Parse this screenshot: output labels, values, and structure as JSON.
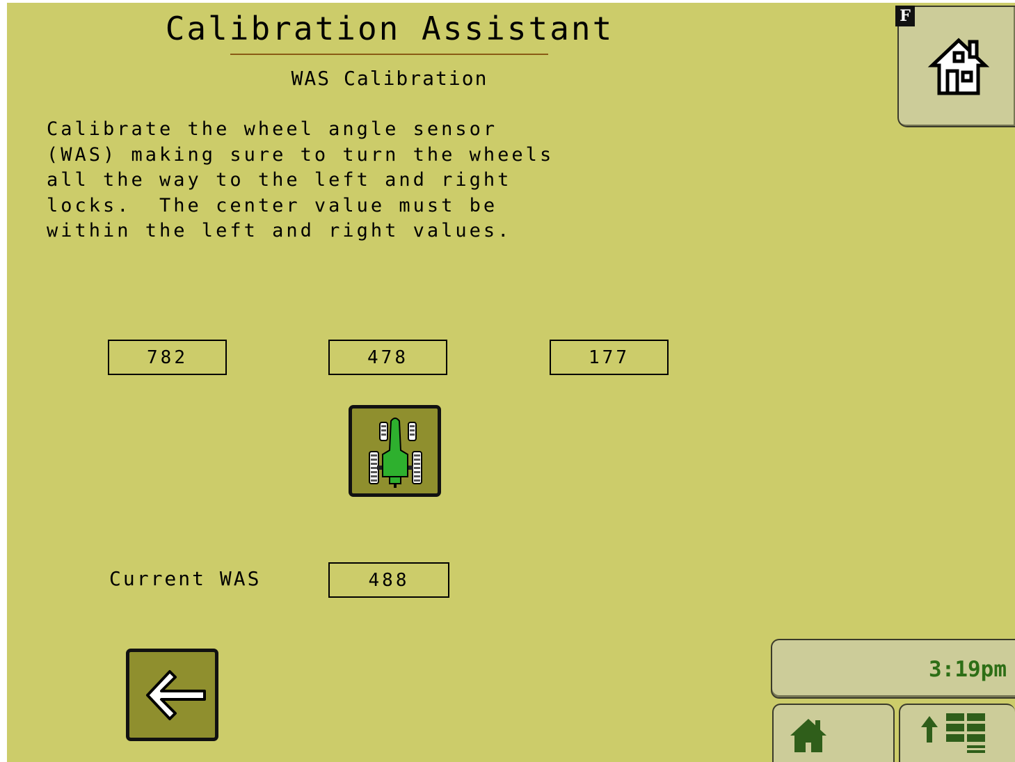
{
  "header": {
    "title": "Calibration Assistant",
    "subtitle": "WAS Calibration"
  },
  "instructions": "Calibrate the wheel angle sensor\n(WAS) making sure to turn the wheels\nall the way to the left and right\nlocks.  The center value must be\nwithin the left and right values.",
  "values": {
    "left": "782",
    "center": "478",
    "right": "177"
  },
  "current": {
    "label": "Current WAS",
    "value": "488"
  },
  "status": {
    "time": "3:19pm",
    "mode_badge": "F"
  },
  "icons": {
    "center_button": "tractor-top-view-icon",
    "back_button": "left-arrow-icon",
    "home_button": "home-outline-icon",
    "nav_home": "home-icon",
    "nav_menu": "up-arrow-grid-icon"
  },
  "colors": {
    "background": "#cccc6a",
    "panel": "#cccc99",
    "button_fill": "#8f8f2e",
    "clock_text": "#2d6e16",
    "accent_green": "#2f5e1a"
  }
}
